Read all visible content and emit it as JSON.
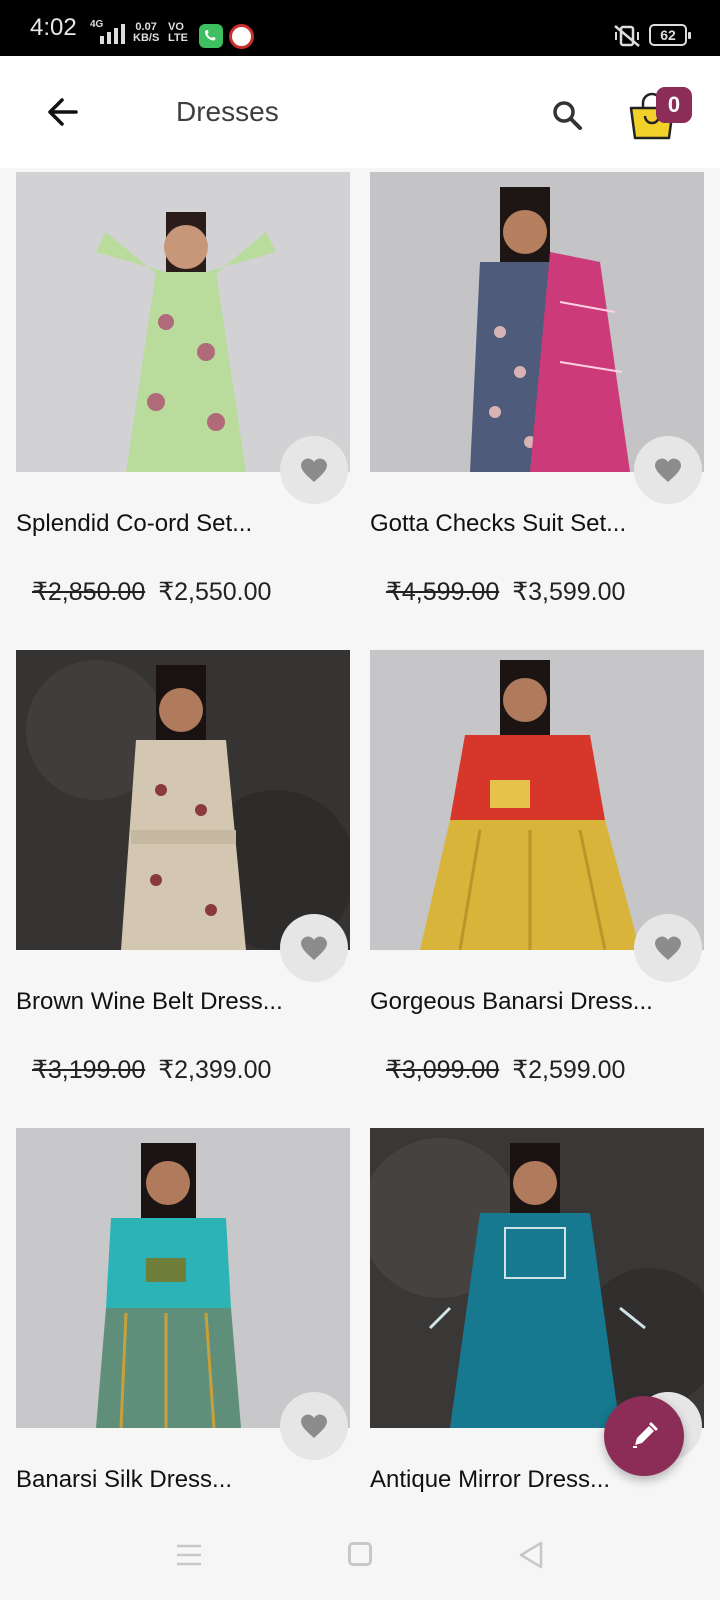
{
  "status_bar": {
    "time": "4:02",
    "network": "4G",
    "speed_value": "0.07",
    "speed_unit": "KB/S",
    "vo": "VO",
    "lte": "LTE",
    "battery": "62"
  },
  "header": {
    "title": "Dresses",
    "cart_count": "0",
    "brand_color": "#8b2d57",
    "cart_color": "#f2d02a"
  },
  "products": [
    {
      "name": "Splendid Co-ord Set...",
      "mrp": "₹2,850.00",
      "price": "₹2,550.00"
    },
    {
      "name": "Gotta Checks Suit Set...",
      "mrp": "₹4,599.00",
      "price": "₹3,599.00"
    },
    {
      "name": "Brown Wine Belt Dress...",
      "mrp": "₹3,199.00",
      "price": "₹2,399.00"
    },
    {
      "name": "Gorgeous Banarsi Dress...",
      "mrp": "₹3,099.00",
      "price": "₹2,599.00"
    },
    {
      "name": "Banarsi Silk Dress...",
      "mrp": "",
      "price": ""
    },
    {
      "name": "Antique Mirror Dress...",
      "mrp": "",
      "price": ""
    }
  ],
  "icons": {
    "back": "arrow-left-icon",
    "search": "search-icon",
    "cart": "shopping-bag-icon",
    "wishlist": "heart-icon",
    "fab": "edit-pencil-icon",
    "nav_menu": "menu-icon",
    "nav_home": "square-home-icon",
    "nav_back": "triangle-back-icon"
  }
}
